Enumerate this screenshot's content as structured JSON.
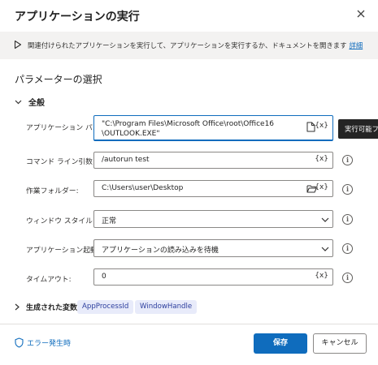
{
  "dialog": {
    "title": "アプリケーションの実行"
  },
  "banner": {
    "description": "関連付けられたアプリケーションを実行して、アプリケーションを実行するか、ドキュメントを開きます",
    "link": "詳細"
  },
  "section": {
    "title": "パラメーターの選択",
    "group": "全般"
  },
  "fields": {
    "app_path": {
      "label": "アプリケーション パス:",
      "value_line1": "\"C:\\Program Files\\Microsoft Office\\root\\Office16",
      "value_line2": "\\OUTLOOK.EXE\"",
      "tooltip": "実行可能ファ"
    },
    "args": {
      "label": "コマンド ライン引数:",
      "value": "/autorun test"
    },
    "workdir": {
      "label": "作業フォルダー:",
      "value": "C:\\Users\\user\\Desktop"
    },
    "window_style": {
      "label": "ウィンドウ スタイル:",
      "value": "正常"
    },
    "after_launch": {
      "label": "アプリケーション起動後:",
      "value": "アプリケーションの読み込みを待機"
    },
    "timeout": {
      "label": "タイムアウト:",
      "value": "0"
    },
    "var_button": "{x}",
    "info_glyph": "i"
  },
  "generated": {
    "label": "生成された変数",
    "vars": [
      "AppProcessId",
      "WindowHandle"
    ]
  },
  "footer": {
    "on_error": "エラー発生時",
    "save": "保存",
    "cancel": "キャンセル"
  },
  "colors": {
    "accent": "#0f6cbd",
    "chip_bg": "#e8ebfa",
    "chip_text": "#2b3d9d",
    "banner_bg": "#f3f2f1"
  }
}
